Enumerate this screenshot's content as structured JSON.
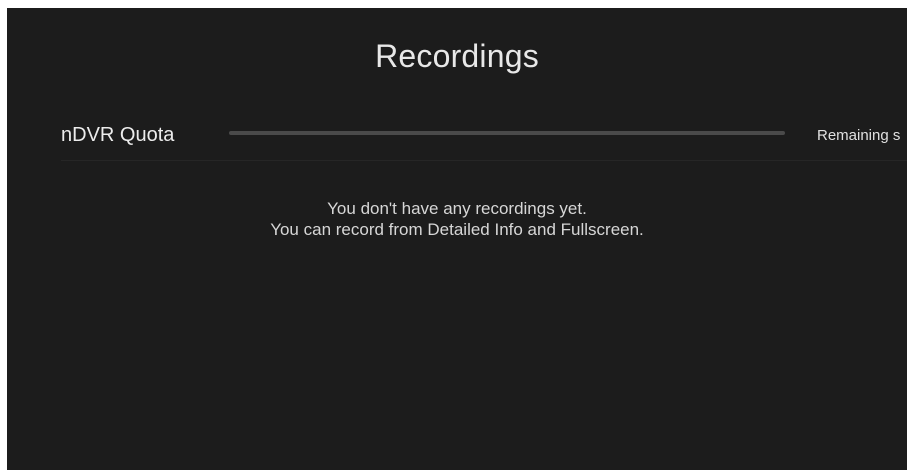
{
  "header": {
    "title": "Recordings"
  },
  "quota": {
    "label": "nDVR Quota",
    "remaining_text": "Remaining s",
    "used_fraction": 0
  },
  "empty_state": {
    "line1": "You don't have any recordings yet.",
    "line2": "You can record from Detailed Info and Fullscreen."
  },
  "colors": {
    "background": "#1c1c1c",
    "track": "#4a4a4a",
    "text": "#e6e6e6"
  }
}
